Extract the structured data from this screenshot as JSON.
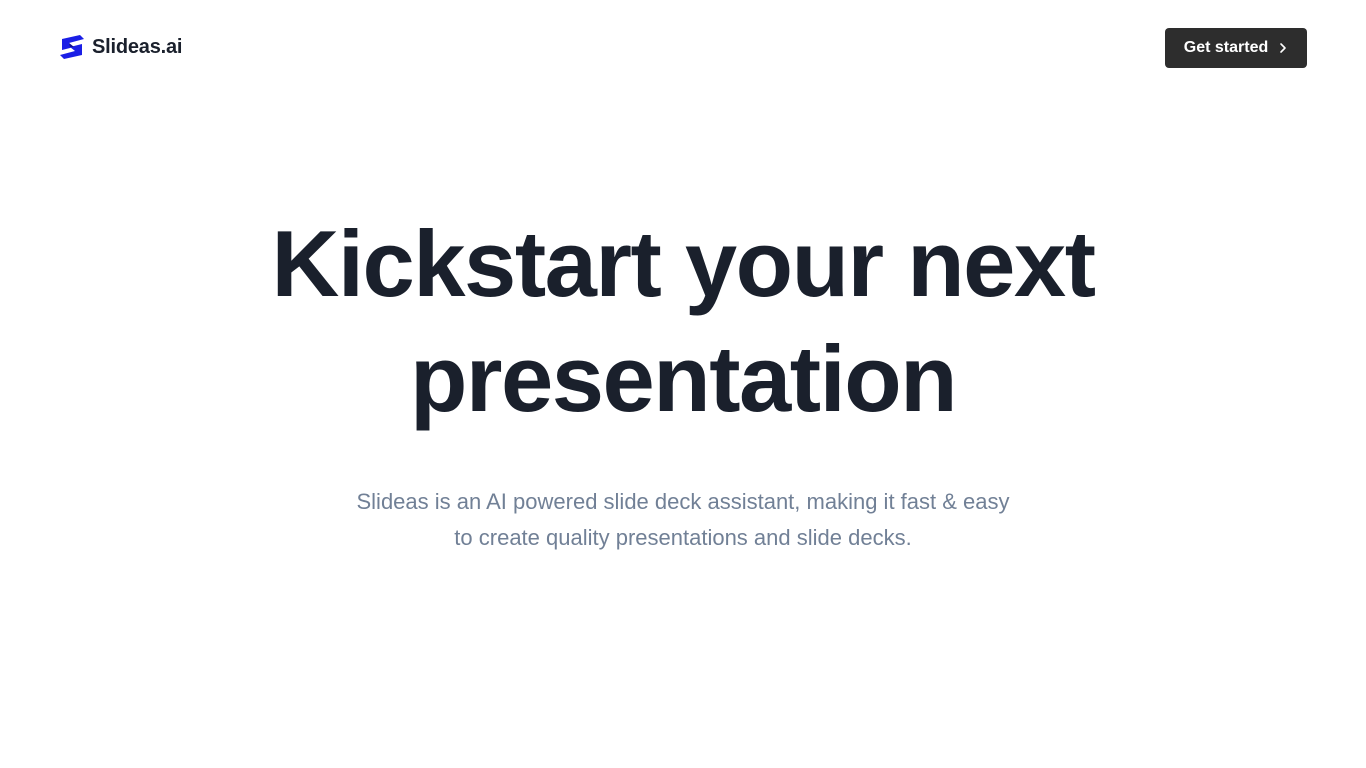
{
  "header": {
    "brand_name": "Slideas.ai",
    "logo_icon": "slideas-s-logo",
    "cta_label": "Get started",
    "cta_icon": "chevron-right-icon"
  },
  "hero": {
    "title": "Kickstart your next presentation",
    "subtitle": "Slideas is an AI powered slide deck assistant, making it fast & easy to create quality presentations and slide decks."
  },
  "colors": {
    "background": "#ffffff",
    "heading": "#1a202c",
    "subtitle": "#718096",
    "button_bg": "#2d2d2d",
    "button_text": "#ffffff",
    "logo_blue": "#1a1ee6",
    "logo_dark_blue": "#0f0f8c"
  }
}
